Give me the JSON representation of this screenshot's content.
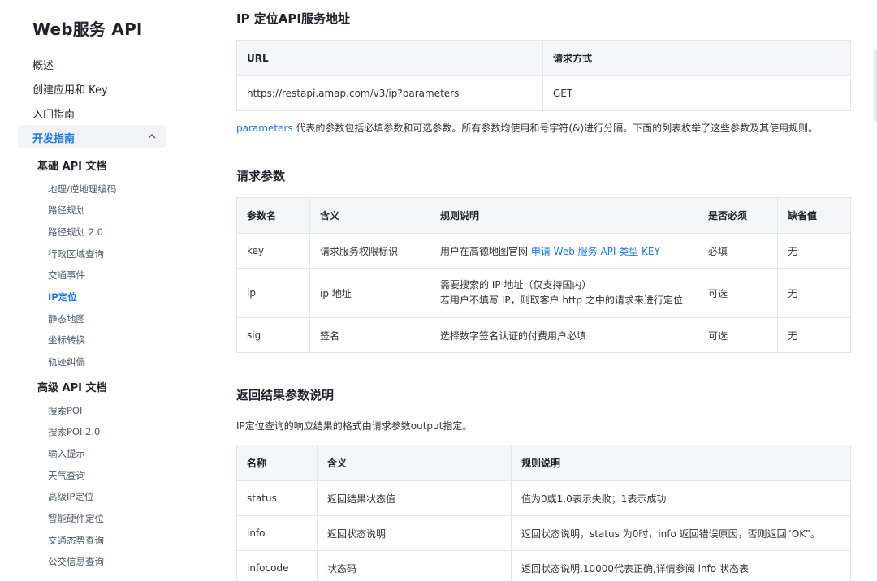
{
  "sidebar": {
    "brand": "Web服务 API",
    "top_items": [
      "概述",
      "创建应用和 Key",
      "入门指南"
    ],
    "active_group": "开发指南",
    "sections": [
      {
        "title": "基础 API 文档",
        "items": [
          "地理/逆地理编码",
          "路径规划",
          "路径规划 2.0",
          "行政区域查询",
          "交通事件",
          "IP定位",
          "静态地图",
          "坐标转换",
          "轨迹纠偏"
        ]
      },
      {
        "title": "高级 API 文档",
        "items": [
          "搜索POI",
          "搜索POI 2.0",
          "输入提示",
          "天气查询",
          "高级IP定位",
          "智能硬件定位",
          "交通态势查询",
          "公交信息查询"
        ]
      }
    ],
    "active_item": "IP定位"
  },
  "service": {
    "title": "IP 定位API服务地址",
    "headers": [
      "URL",
      "请求方式"
    ],
    "row": [
      "https://restapi.amap.com/v3/ip?parameters",
      "GET"
    ],
    "note_link": "parameters",
    "note_text": " 代表的参数包括必填参数和可选参数。所有参数均使用和号字符(&)进行分隔。下面的列表枚举了这些参数及其使用规则。"
  },
  "request": {
    "title": "请求参数",
    "headers": [
      "参数名",
      "含义",
      "规则说明",
      "是否必须",
      "缺省值"
    ],
    "rows": [
      {
        "name": "key",
        "meaning": "请求服务权限标识",
        "rule_pre": "用户在高德地图官网 ",
        "rule_link": "申请 Web 服务 API 类型 KEY",
        "required": "必填",
        "default": "无"
      },
      {
        "name": "ip",
        "meaning": "ip 地址",
        "rule_line1": "需要搜索的 IP 地址（仅支持国内）",
        "rule_line2": "若用户不填写 IP，则取客户 http 之中的请求来进行定位",
        "required": "可选",
        "default": "无"
      },
      {
        "name": "sig",
        "meaning": "签名",
        "rule": "选择数字签名认证的付费用户必填",
        "required": "可选",
        "default": "无"
      }
    ]
  },
  "response": {
    "title": "返回结果参数说明",
    "intro": "IP定位查询的响应结果的格式由请求参数output指定。",
    "headers": [
      "名称",
      "含义",
      "规则说明"
    ],
    "rows": [
      [
        "status",
        "返回结果状态值",
        "值为0或1,0表示失败；1表示成功"
      ],
      [
        "info",
        "返回状态说明",
        "返回状态说明，status 为0时，info 返回错误原因，否则返回“OK”。"
      ],
      [
        "infocode",
        "状态码",
        "返回状态说明,10000代表正确,详情参阅 info 状态表"
      ]
    ]
  }
}
